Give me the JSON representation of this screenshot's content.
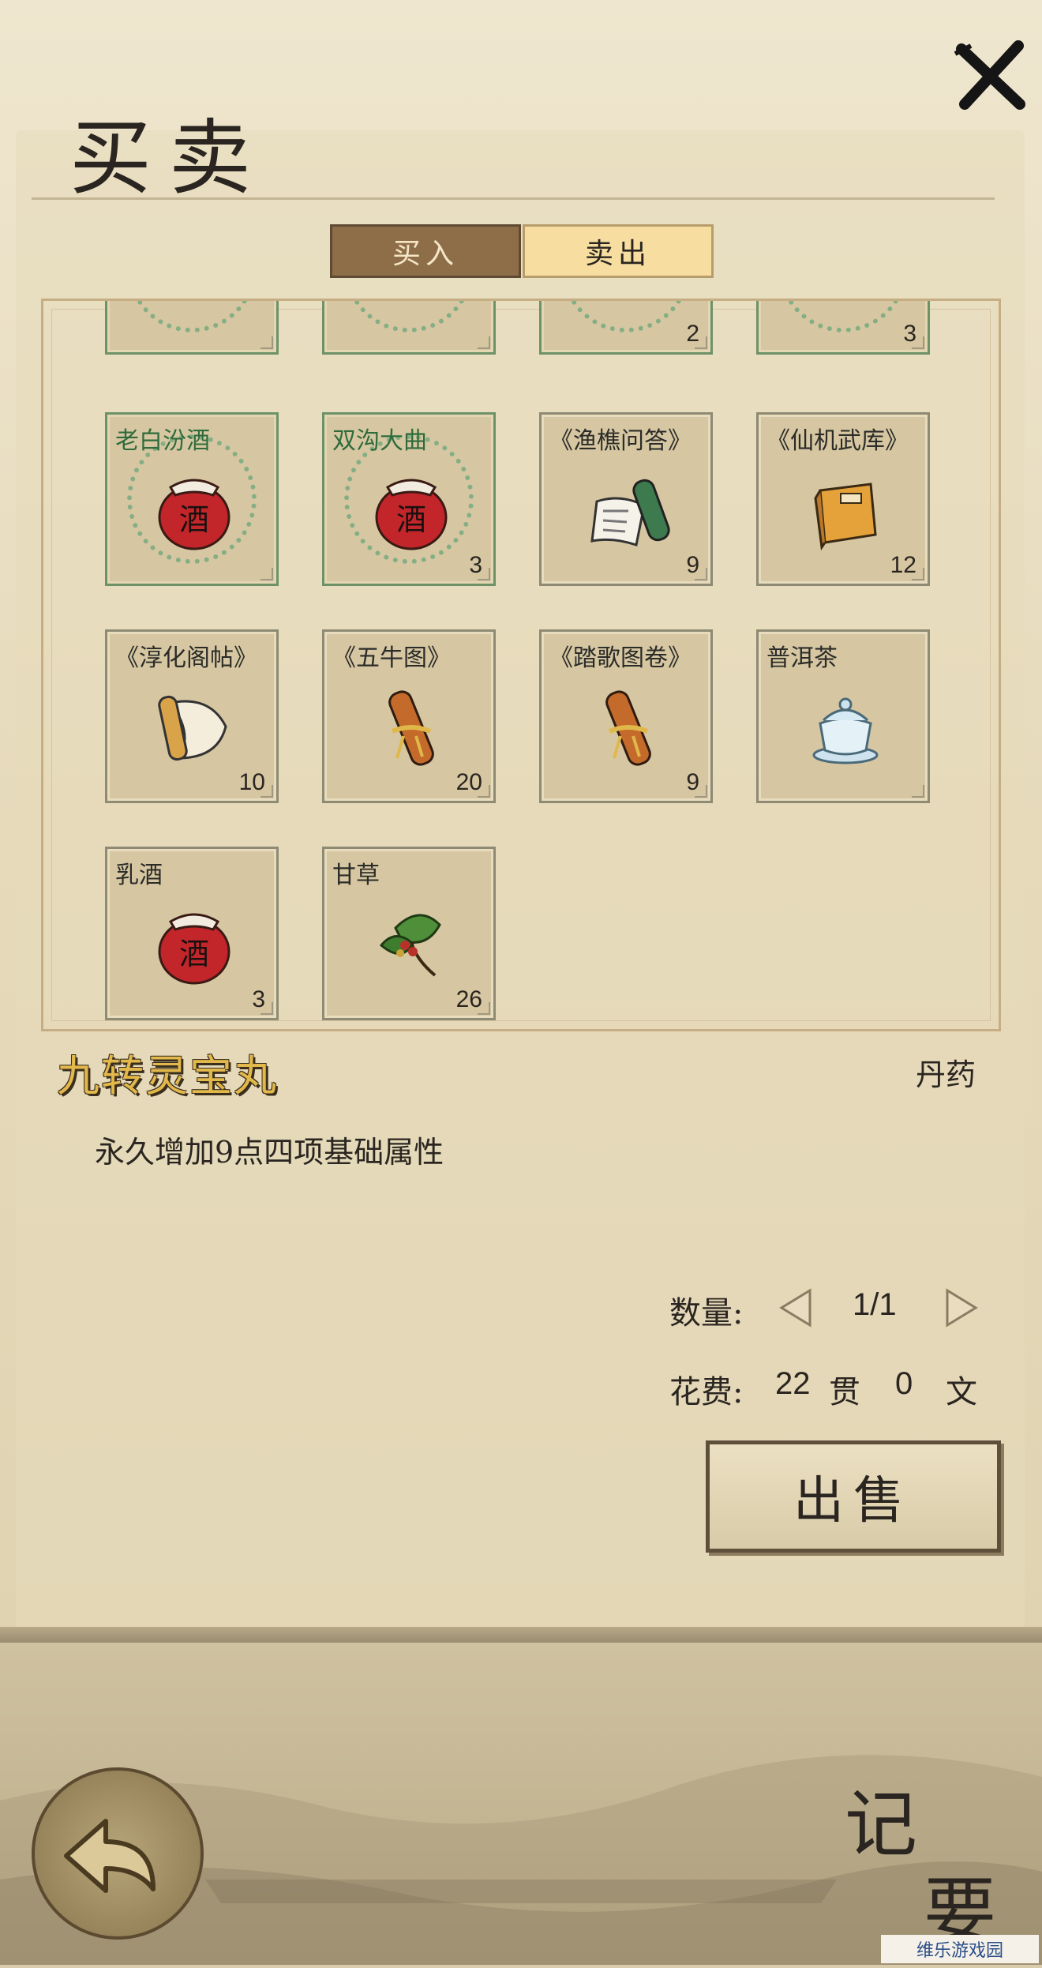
{
  "header": {
    "title": "买卖",
    "close_label": "✕"
  },
  "tabs": [
    {
      "label": "买入",
      "active": false
    },
    {
      "label": "卖出",
      "active": true
    }
  ],
  "inventory": {
    "partial_row": [
      {
        "label": "",
        "count": "",
        "icon": "scroll-icon"
      },
      {
        "label": "",
        "count": "",
        "icon": "scroll-icon"
      },
      {
        "label": "",
        "count": "2",
        "icon": "tea-cup-icon"
      },
      {
        "label": "",
        "count": "3",
        "icon": "tea-cup-icon"
      }
    ],
    "rows": [
      [
        {
          "label": "老白汾酒",
          "count": "",
          "icon": "wine-jar-icon",
          "highlight": true
        },
        {
          "label": "双沟大曲",
          "count": "3",
          "icon": "wine-jar-icon",
          "highlight": true
        },
        {
          "label": "《渔樵问答》",
          "count": "9",
          "icon": "open-scroll-icon",
          "highlight": false
        },
        {
          "label": "《仙机武库》",
          "count": "12",
          "icon": "book-icon",
          "highlight": false
        }
      ],
      [
        {
          "label": "《淳化阁帖》",
          "count": "10",
          "icon": "paper-scroll-icon",
          "highlight": false
        },
        {
          "label": "《五牛图》",
          "count": "20",
          "icon": "rolled-scroll-icon",
          "highlight": false
        },
        {
          "label": "《踏歌图卷》",
          "count": "9",
          "icon": "rolled-scroll-icon",
          "highlight": false
        },
        {
          "label": "普洱茶",
          "count": "",
          "icon": "tea-cup-icon",
          "highlight": false
        }
      ],
      [
        {
          "label": "乳酒",
          "count": "3",
          "icon": "wine-jar-icon",
          "highlight": false
        },
        {
          "label": "甘草",
          "count": "26",
          "icon": "herb-icon",
          "highlight": false
        }
      ]
    ]
  },
  "detail": {
    "name": "九转灵宝丸",
    "type": "丹药",
    "description": "永久增加9点四项基础属性"
  },
  "quantity": {
    "label": "数量:",
    "value": "1/1"
  },
  "cost": {
    "label": "花费:",
    "guan": "22",
    "guan_unit": "贯",
    "wen": "0",
    "wen_unit": "文"
  },
  "sell_button": {
    "label": "出售"
  },
  "bottom": {
    "notes_top": "记",
    "notes_bottom": "要"
  },
  "watermark": "维乐游戏园"
}
